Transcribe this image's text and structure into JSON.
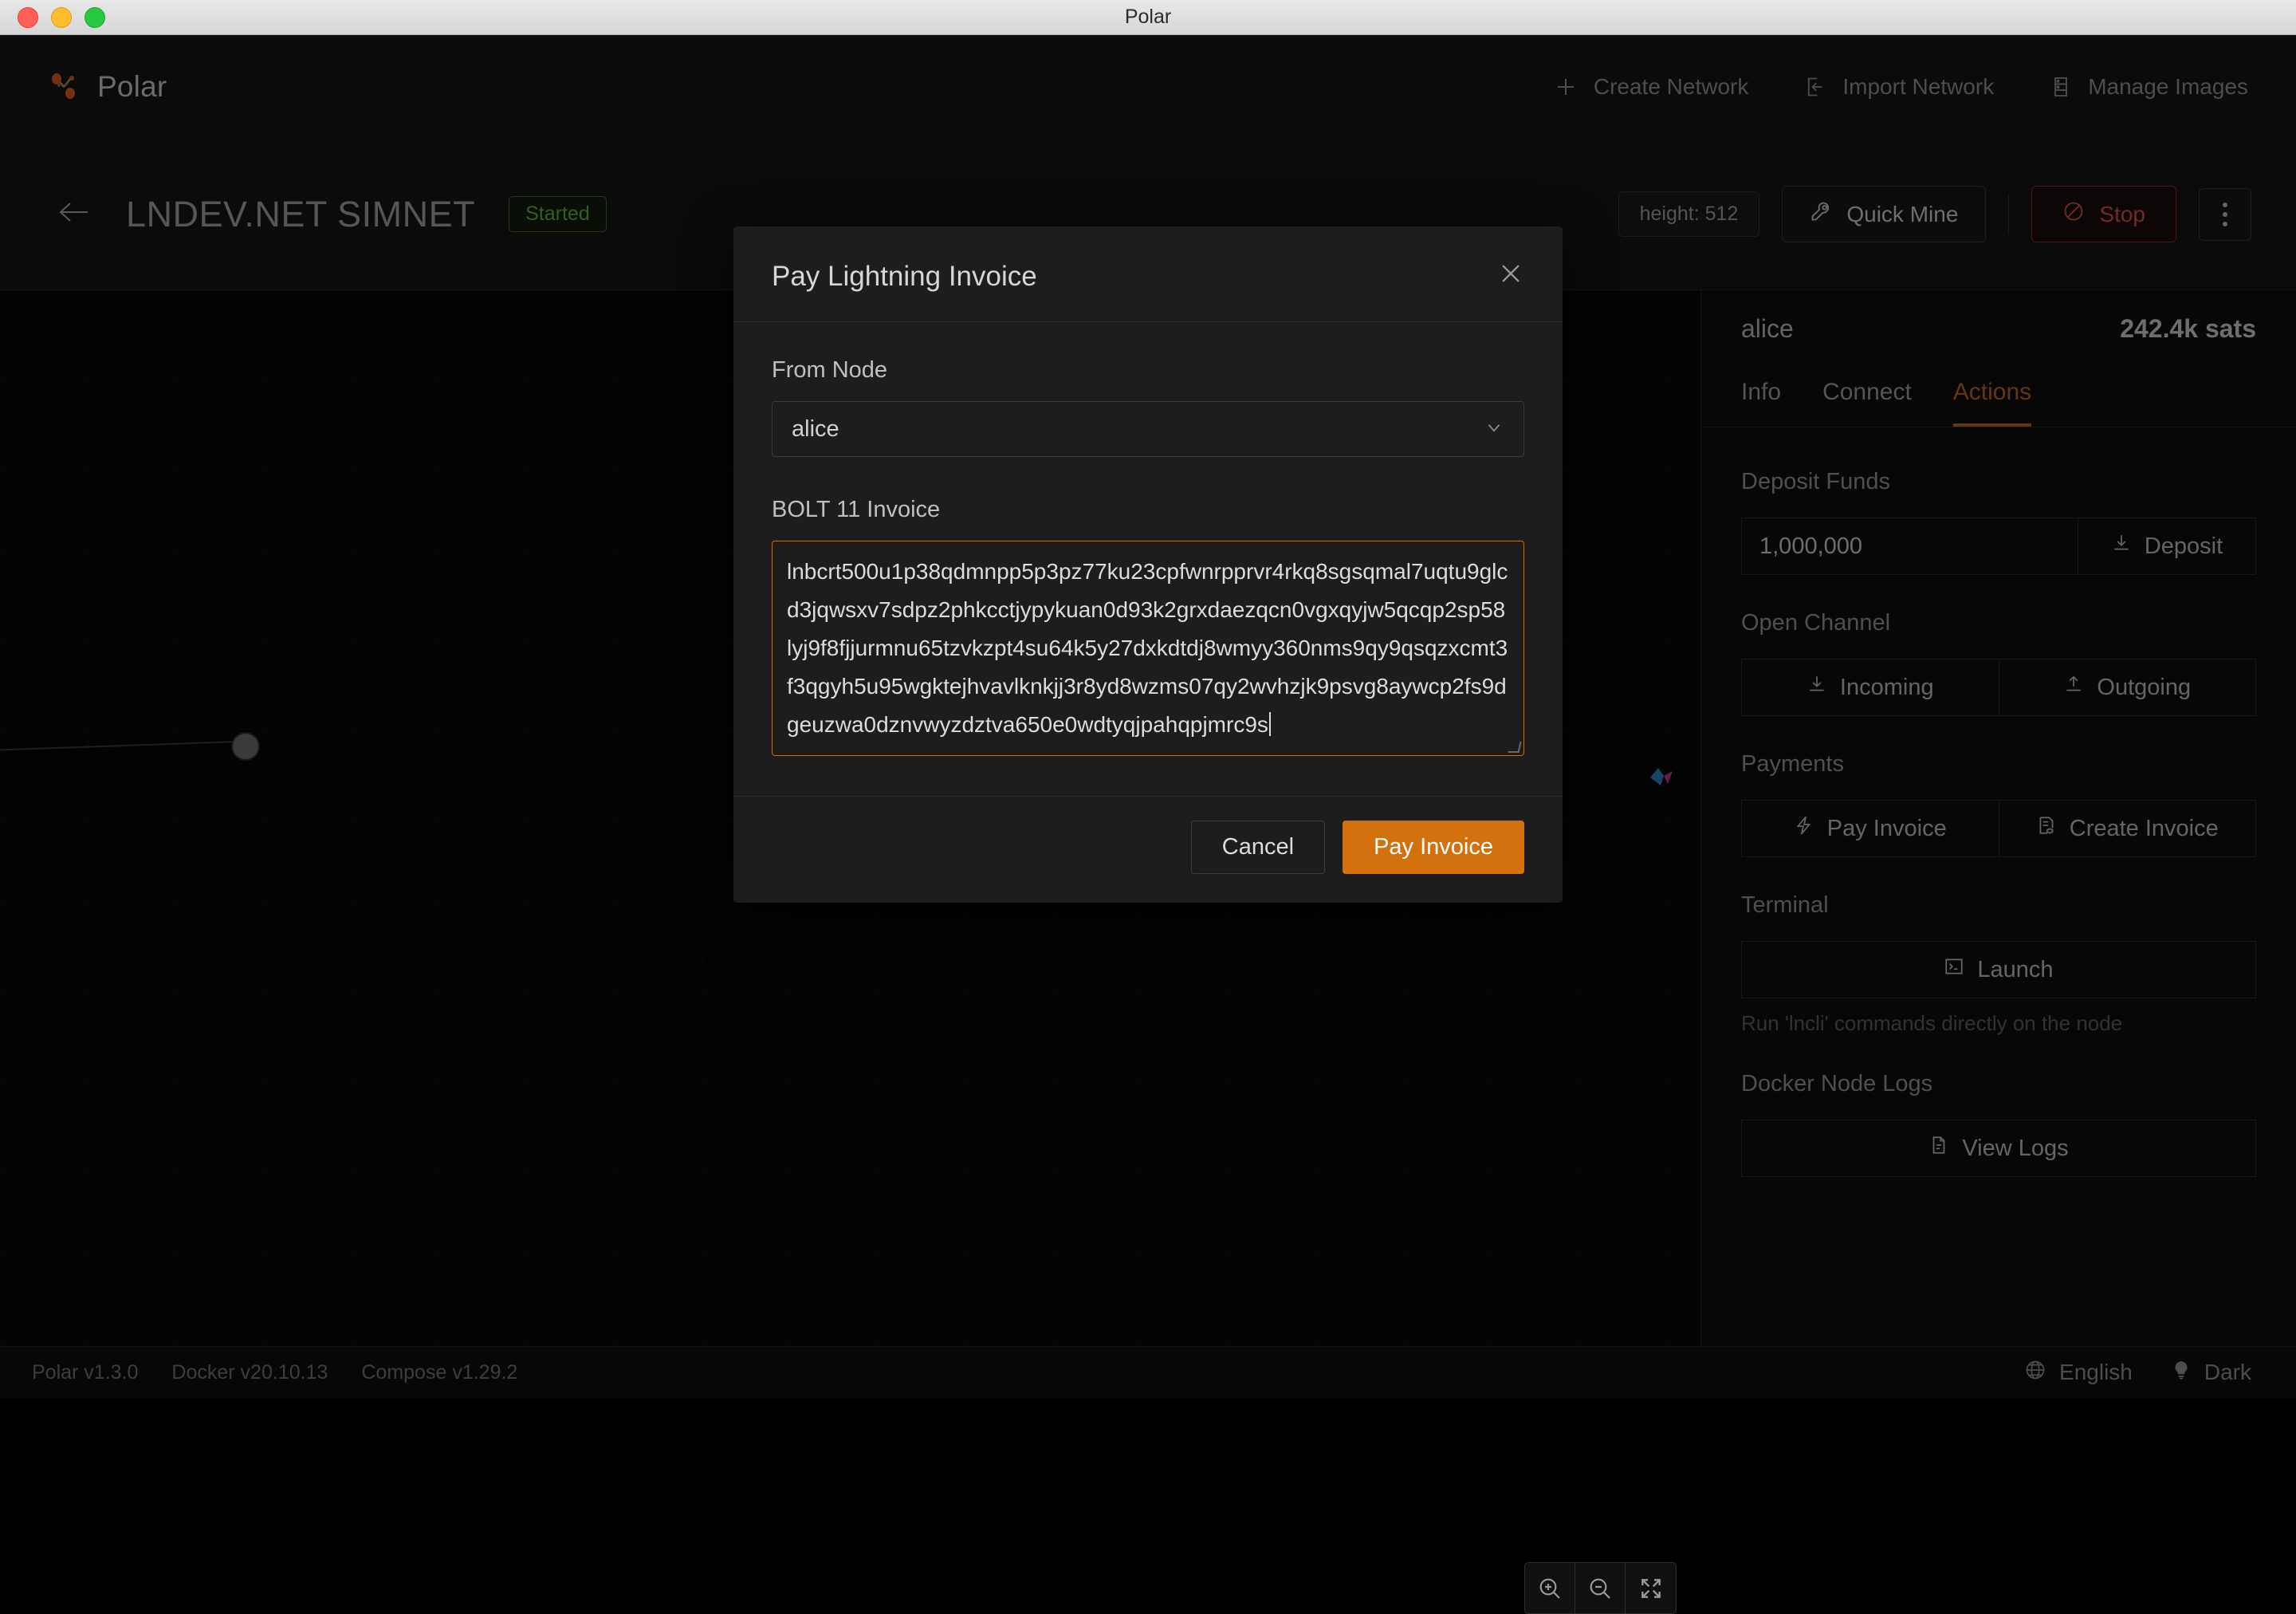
{
  "window": {
    "title": "Polar",
    "traffic_lights": [
      "close",
      "minimize",
      "zoom"
    ]
  },
  "navbar": {
    "brand": "Polar",
    "actions": [
      {
        "label": "Create Network",
        "icon": "plus-icon"
      },
      {
        "label": "Import Network",
        "icon": "import-icon"
      },
      {
        "label": "Manage Images",
        "icon": "server-icon"
      }
    ]
  },
  "network_header": {
    "back_icon": "arrow-left-icon",
    "title": "LNDEV.NET SIMNET",
    "status_badge": "Started",
    "height_chip": "height: 512",
    "quick_mine_label": "Quick Mine",
    "stop_label": "Stop",
    "more_icon": "kebab-icon"
  },
  "canvas": {
    "zoom_in_label": "zoom-in",
    "zoom_out_label": "zoom-out",
    "fit_label": "fit-to-screen"
  },
  "sidebar": {
    "node_name": "alice",
    "balance": "242.4k sats",
    "tabs": [
      {
        "label": "Info",
        "active": false
      },
      {
        "label": "Connect",
        "active": false
      },
      {
        "label": "Actions",
        "active": true
      }
    ],
    "deposit": {
      "title": "Deposit Funds",
      "amount": "1,000,000",
      "button": "Deposit"
    },
    "open_channel": {
      "title": "Open Channel",
      "incoming": "Incoming",
      "outgoing": "Outgoing"
    },
    "payments": {
      "title": "Payments",
      "pay_invoice": "Pay Invoice",
      "create_invoice": "Create Invoice"
    },
    "terminal": {
      "title": "Terminal",
      "launch": "Launch",
      "hint": "Run 'lncli' commands directly on the node"
    },
    "docker_logs": {
      "title": "Docker Node Logs",
      "view_logs": "View Logs"
    }
  },
  "statusbar": {
    "polar_version": "Polar v1.3.0",
    "docker_version": "Docker v20.10.13",
    "compose_version": "Compose v1.29.2",
    "language": "English",
    "theme": "Dark"
  },
  "modal": {
    "title": "Pay Lightning Invoice",
    "close_icon": "close-icon",
    "from_node_label": "From Node",
    "from_node_value": "alice",
    "invoice_label": "BOLT 11 Invoice",
    "invoice_value": "lnbcrt500u1p38qdmnpp5p3pz77ku23cpfwnrpprvr4rkq8sgsqmal7uqtu9glcd3jqwsxv7sdpz2phkcctjypykuan0d93k2grxdaezqcn0vgxqyjw5qcqp2sp58lyj9f8fjjurmnu65tzvkzpt4su64k5y27dxkdtdj8wmyy360nms9qy9qsqzxcmt3f3qgyh5u95wgktejhvavlknkjj3r8yd8wzms07qy2wvhzjk9psvg8aywcp2fs9dgeuzwa0dznvwyzdztva650e0wdtyqjpahqpjmrc9s",
    "cancel_label": "Cancel",
    "submit_label": "Pay Invoice"
  },
  "colors": {
    "accent": "#d4710f",
    "accent_tab": "#b5641b",
    "danger": "#cf4b4b",
    "success": "#64a938",
    "background": "#141414"
  }
}
